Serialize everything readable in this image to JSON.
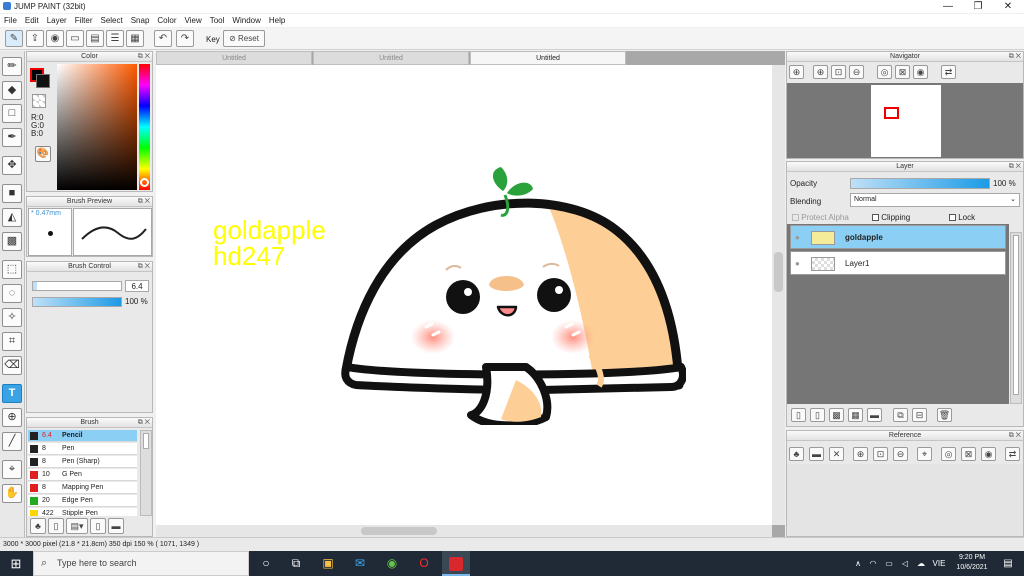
{
  "app": {
    "title": "JUMP PAINT (32bit)",
    "window_buttons": [
      "—",
      "❐",
      "✕"
    ]
  },
  "menu": [
    "File",
    "Edit",
    "Layer",
    "Filter",
    "Select",
    "Snap",
    "Color",
    "View",
    "Tool",
    "Window",
    "Help"
  ],
  "toolbar": {
    "key_label": "Key",
    "reset_label": "Reset"
  },
  "color_panel": {
    "title": "Color",
    "r": "R:0",
    "g": "G:0",
    "b": "B:0"
  },
  "brush_preview": {
    "title": "Brush Preview",
    "size_label": "* 0.47mm"
  },
  "brush_control": {
    "title": "Brush Control",
    "size_value": "6.4",
    "opacity_value": "100 %",
    "size_fraction": 0.05,
    "opacity_fraction": 1.0
  },
  "brush_panel": {
    "title": "Brush",
    "items": [
      {
        "size": "6.4",
        "name": "Pencil",
        "color": "#222222"
      },
      {
        "size": "8",
        "name": "Pen",
        "color": "#222222"
      },
      {
        "size": "8",
        "name": "Pen (Sharp)",
        "color": "#222222"
      },
      {
        "size": "10",
        "name": "G Pen",
        "color": "#e02020"
      },
      {
        "size": "8",
        "name": "Mapping Pen",
        "color": "#e02020"
      },
      {
        "size": "20",
        "name": "Edge Pen",
        "color": "#22aa22"
      },
      {
        "size": "422",
        "name": "Stipple Pen",
        "color": "#ffd400"
      }
    ]
  },
  "tabs": [
    "Untitled",
    "Untitled",
    "Untitled"
  ],
  "canvas": {
    "watermark_line1": "goldapple",
    "watermark_line2": "hd247"
  },
  "status": {
    "text": "3000 * 3000 pixel  (21.8 * 21.8cm)  350 dpi  150 %  ( 1071, 1349 )"
  },
  "navigator": {
    "title": "Navigator"
  },
  "layer_panel": {
    "title": "Layer",
    "opacity_label": "Opacity",
    "opacity_value": "100 %",
    "opacity_fraction": 1.0,
    "blending_label": "Blending",
    "blending_value": "Normal",
    "protect_alpha": "Protect Alpha",
    "clipping": "Clipping",
    "lock": "Lock",
    "layers": [
      {
        "name": "goldapple",
        "selected": true
      },
      {
        "name": "Layer1",
        "selected": false
      }
    ]
  },
  "reference": {
    "title": "Reference"
  },
  "taskbar": {
    "search_placeholder": "Type here to search",
    "lang": "VIE",
    "time": "9:20 PM",
    "date": "10/6/2021"
  },
  "colors": {
    "accent": "#1c9be6",
    "watermark": "#ffff00",
    "mushroom_orange": "#fdcf96",
    "leaf": "#2aa13a"
  }
}
